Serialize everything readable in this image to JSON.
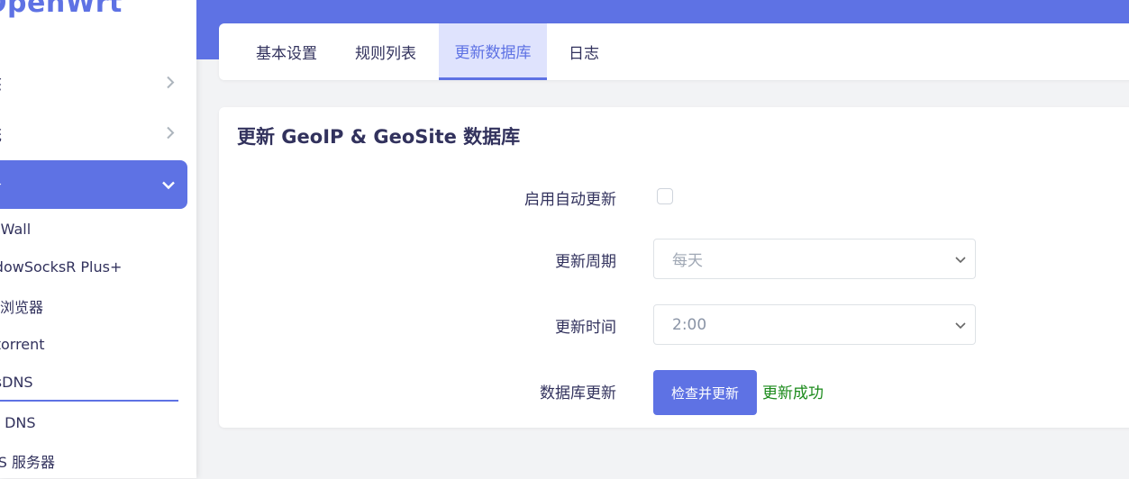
{
  "app": {
    "logo_text": "OpenWrt"
  },
  "sidebar": {
    "items": [
      {
        "label": "态"
      },
      {
        "label": "统"
      },
      {
        "label": "务"
      }
    ],
    "sub_items": [
      {
        "label": "ssWall"
      },
      {
        "label": "adowSocksR Plus+"
      },
      {
        "label": "件浏览器"
      },
      {
        "label": "ittorrent"
      },
      {
        "label": "osDNS"
      },
      {
        "label": "态 DNS"
      },
      {
        "label": "MS 服务器"
      }
    ]
  },
  "tabs": [
    {
      "label": "基本设置"
    },
    {
      "label": "规则列表"
    },
    {
      "label": "更新数据库"
    },
    {
      "label": "日志"
    }
  ],
  "section": {
    "title": "更新 GeoIP & GeoSite 数据库",
    "auto_update_label": "启用自动更新",
    "auto_update_checked": false,
    "period_label": "更新周期",
    "period_value": "每天",
    "time_label": "更新时间",
    "time_value": "2:00",
    "db_update_label": "数据库更新",
    "check_button_label": "检查并更新",
    "status_text": "更新成功"
  },
  "colors": {
    "accent": "#5e72e4",
    "tab_active_bg": "#dfe3fd",
    "success": "#1a8a1a"
  },
  "icons": {
    "nav_collapsed": "chevron-right-icon",
    "nav_expanded": "chevron-down-icon",
    "select": "chevron-down-icon"
  }
}
